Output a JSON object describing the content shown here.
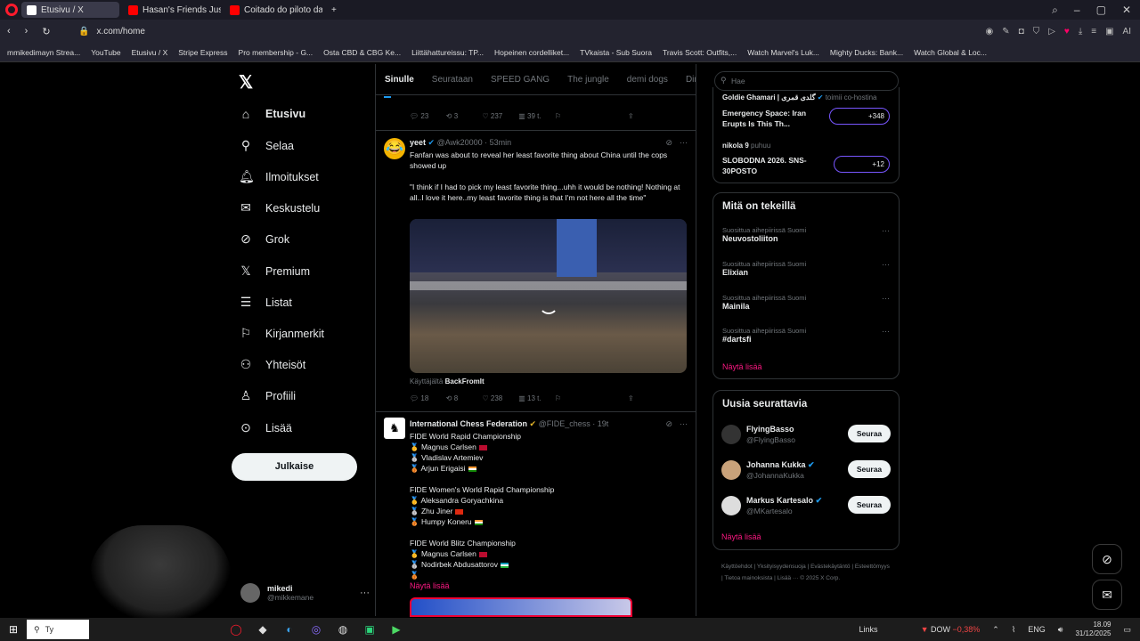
{
  "browser": {
    "tabs": [
      {
        "label": "Etusivu / X",
        "active": true
      },
      {
        "label": "Hasan's Friends Just Expo"
      },
      {
        "label": "Coitado do piloto da Mot"
      }
    ],
    "url": "x.com/home",
    "bookmarks": [
      "mmikedimayn Strea...",
      "YouTube",
      "Etusivu / X",
      "Stripe Express",
      "Pro membership - G...",
      "Osta CBD & CBG Ke...",
      "Liittähattureissu: TP...",
      "Hopeinen cordelliket...",
      "TVkaista - Sub Suora",
      "Travis Scott: Outfits,...",
      "Watch Marvel's Luk...",
      "Mighty Ducks: Bank...",
      "Watch Global & Loc..."
    ]
  },
  "sidebar": {
    "items": [
      {
        "label": "Etusivu",
        "icon": "home-icon"
      },
      {
        "label": "Selaa",
        "icon": "search-icon"
      },
      {
        "label": "Ilmoitukset",
        "icon": "bell-icon"
      },
      {
        "label": "Keskustelu",
        "icon": "mail-icon"
      },
      {
        "label": "Grok",
        "icon": "grok-icon"
      },
      {
        "label": "Premium",
        "icon": "x-icon"
      },
      {
        "label": "Listat",
        "icon": "list-icon"
      },
      {
        "label": "Kirjanmerkit",
        "icon": "bookmark-icon"
      },
      {
        "label": "Yhteisöt",
        "icon": "people-icon"
      },
      {
        "label": "Profiili",
        "icon": "person-icon"
      },
      {
        "label": "Lisää",
        "icon": "more-icon"
      }
    ],
    "post_label": "Julkaise",
    "account": {
      "name": "mikedi",
      "handle": "@mikkemane"
    }
  },
  "feed": {
    "tabs": [
      "Sinulle",
      "Seurataan",
      "SPEED GANG",
      "The jungle",
      "demi dogs",
      "Dima's DI"
    ],
    "top_actions": {
      "replies": "23",
      "reposts": "3",
      "likes": "237",
      "views": "39 t."
    },
    "tweet1": {
      "name": "yeet",
      "handle": "@Awk20000",
      "time": "53min",
      "text": "Fanfan was about to reveal her least favorite thing about China until the cops showed up\n\n\"I think if I had to pick my least favorite thing...uhh it would be nothing! Nothing at all..I love it here..my least favorite thing is that I'm not here all the time\"",
      "media_credit_prefix": "Käyttäjältä",
      "media_credit": "BackFromIt",
      "replies": "18",
      "reposts": "8",
      "likes": "238",
      "views": "13 t."
    },
    "tweet2": {
      "name": "International Chess Federation",
      "handle": "@FIDE_chess",
      "time": "19t",
      "lines": [
        "FIDE World Rapid Championship",
        "Magnus Carlsen",
        "Vladislav Artemiev",
        "Arjun Erigaisi",
        "",
        "FIDE Women's World Rapid Championship",
        "Aleksandra Goryachkina",
        "Zhu Jiner",
        "Humpy Koneru",
        "",
        "FIDE World Blitz Championship",
        "Magnus Carlsen",
        "Nodirbek Abdusattorov"
      ],
      "show_more": "Näytä lisää"
    }
  },
  "right": {
    "search_placeholder": "Hae",
    "spaces": [
      {
        "host": "Goldie Ghamari | گلدی قمری",
        "role": "toimii co-hostina",
        "title": "Emergency Space: Iran Erupts Is This Th...",
        "count": "+348"
      },
      {
        "host": "nikola 9",
        "role": "puhuu",
        "title": "SLOBODNA 2026. SNS-30POSTO",
        "count": "+12"
      }
    ],
    "trends_title": "Mitä on tekeillä",
    "trends": [
      {
        "sub": "Suosittua aihepiirissä Suomi",
        "title": "Neuvostoliiton"
      },
      {
        "sub": "Suosittua aihepiirissä Suomi",
        "title": "Elixian"
      },
      {
        "sub": "Suosittua aihepiirissä Suomi",
        "title": "Mainila"
      },
      {
        "sub": "Suosittua aihepiirissä Suomi",
        "title": "#dartsfi"
      }
    ],
    "show_more": "Näytä lisää",
    "who_title": "Uusia seurattavia",
    "who": [
      {
        "name": "FlyingBasso",
        "handle": "@FlyingBasso",
        "button": "Seuraa"
      },
      {
        "name": "Johanna Kukka",
        "handle": "@JohannaKukka",
        "button": "Seuraa"
      },
      {
        "name": "Markus Kartesalo",
        "handle": "@MKartesalo",
        "button": "Seuraa"
      }
    ],
    "footer": "Käyttöehdot | Yksityisyydensuoja | Evästekäytäntö | Esteettömyys | Tietoa mainoksista | Lisää ··· © 2025 X Corp."
  },
  "taskbar": {
    "search": "Ty",
    "links": "Links",
    "ticker": "DOW",
    "ticker_change": "−0,38%",
    "lang": "ENG",
    "time": "18.09",
    "date": "31/12/2025"
  }
}
